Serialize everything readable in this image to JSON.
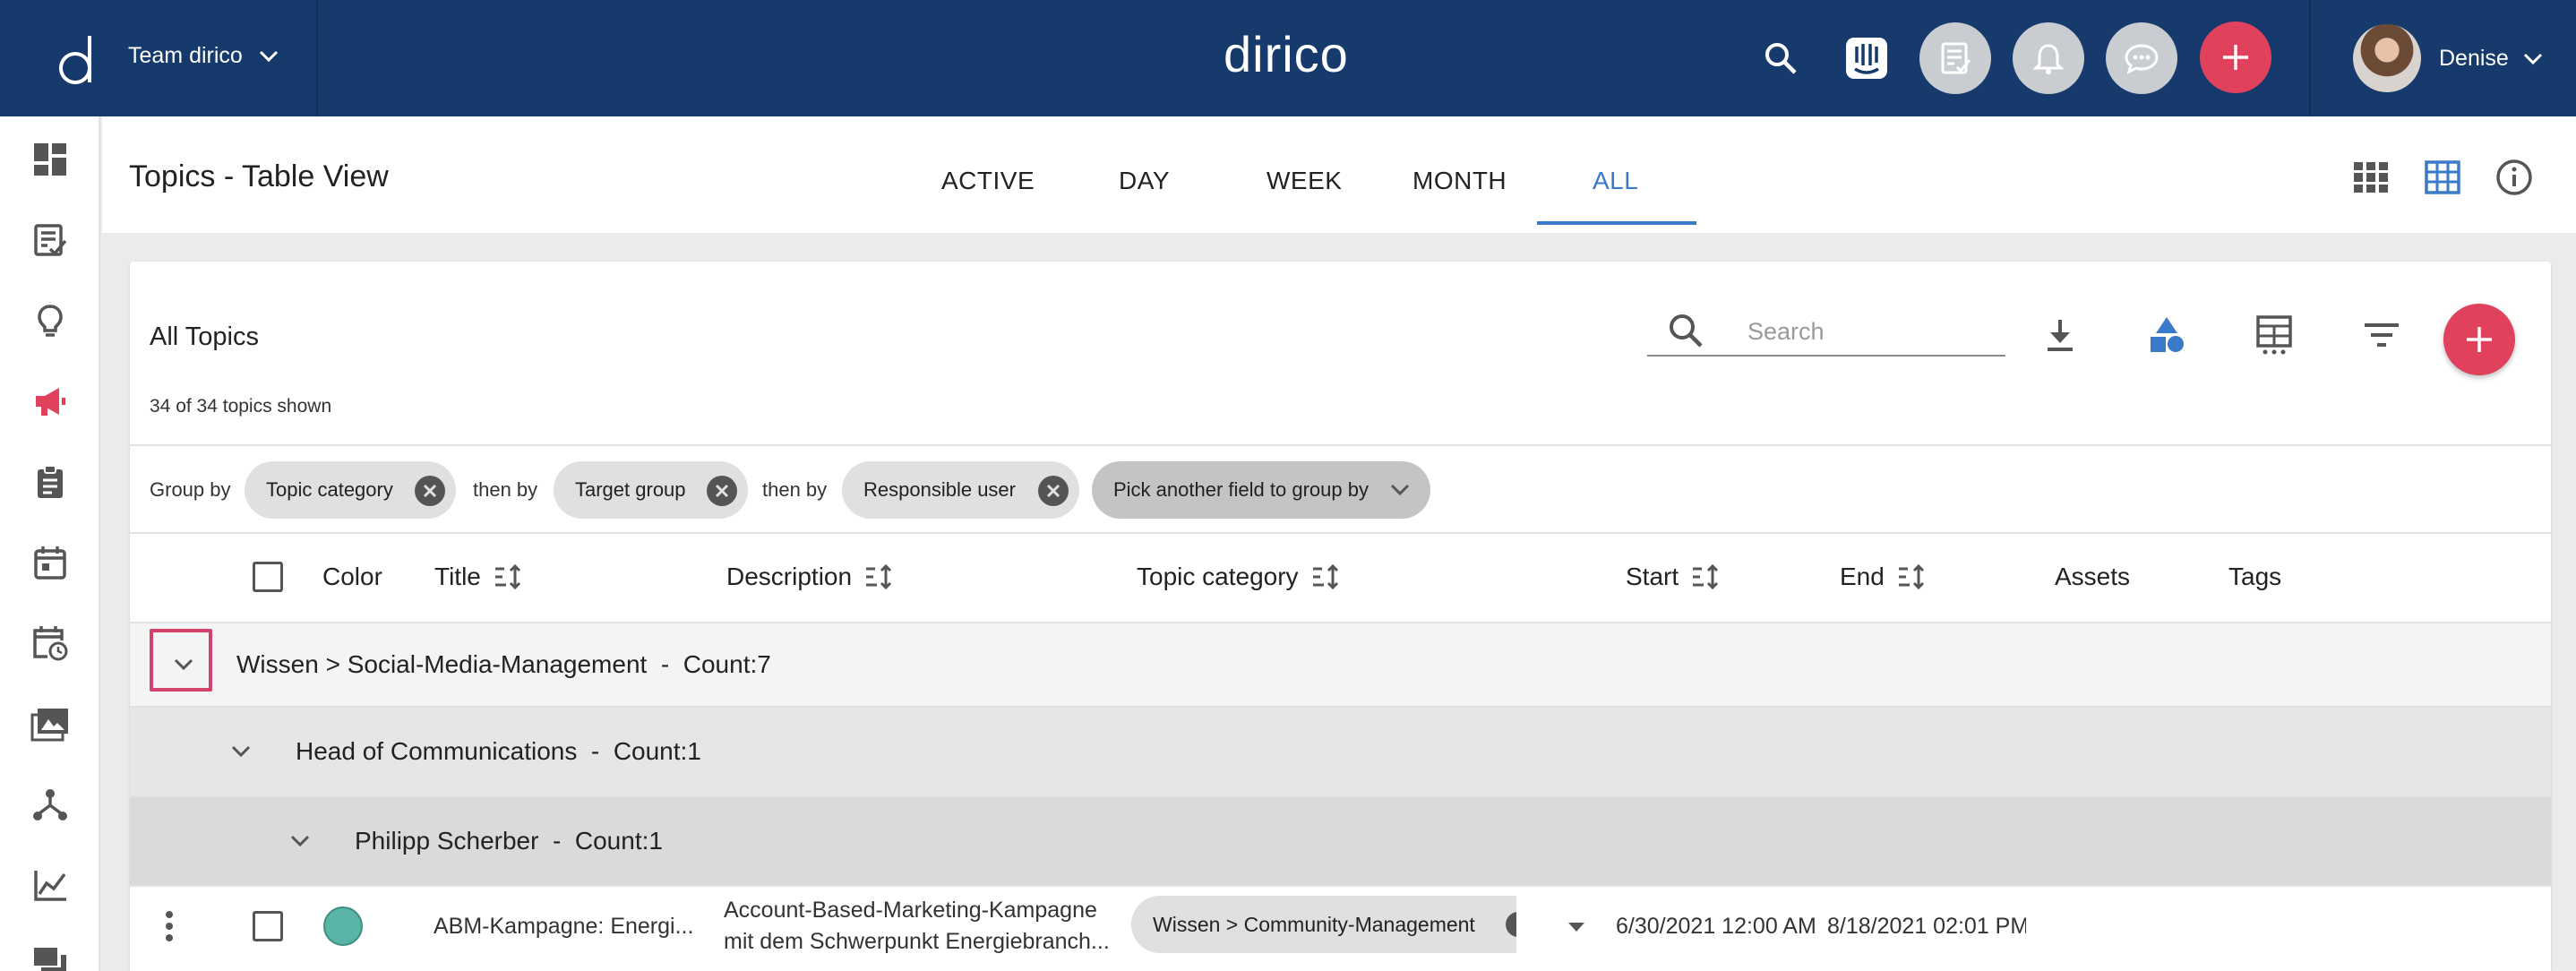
{
  "topbar": {
    "team_name": "Team dirico",
    "brand": "dirico",
    "user_name": "Denise"
  },
  "header": {
    "page_title": "Topics - Table View",
    "tabs": [
      {
        "label": "ACTIVE"
      },
      {
        "label": "DAY"
      },
      {
        "label": "WEEK"
      },
      {
        "label": "MONTH"
      },
      {
        "label": "ALL",
        "active": true
      }
    ]
  },
  "card": {
    "title": "All Topics",
    "subtitle": "34 of 34 topics shown",
    "search_placeholder": "Search"
  },
  "group_by": {
    "label": "Group by",
    "then_label": "then by",
    "chips": [
      "Topic category",
      "Target group",
      "Responsible user"
    ],
    "pick_label": "Pick another field to group by"
  },
  "table": {
    "columns": [
      "Color",
      "Title",
      "Description",
      "Topic category",
      "Start",
      "End",
      "Assets",
      "Tags"
    ],
    "groups": [
      {
        "label": "Wissen > Social-Media-Management  -  Count:7"
      },
      {
        "label": "Head of Communications  -  Count:1"
      },
      {
        "label": "Philipp Scherber  -  Count:1"
      }
    ],
    "rows": [
      {
        "color": "#5bb5a6",
        "title": "ABM-Kampagne: Energi...",
        "description_line1": "Account-Based-Marketing-Kampagne",
        "description_line2": "mit dem Schwerpunkt Energiebranch...",
        "topic_category": "Wissen > Community-Management",
        "start": "6/30/2021 12:00 AM",
        "end": "8/18/2021 02:01 PM"
      }
    ]
  },
  "colors": {
    "topbar": "#163a6c",
    "accent": "#3b7ac9",
    "fab": "#e0415d",
    "active_sidebar": "#e0415d"
  }
}
